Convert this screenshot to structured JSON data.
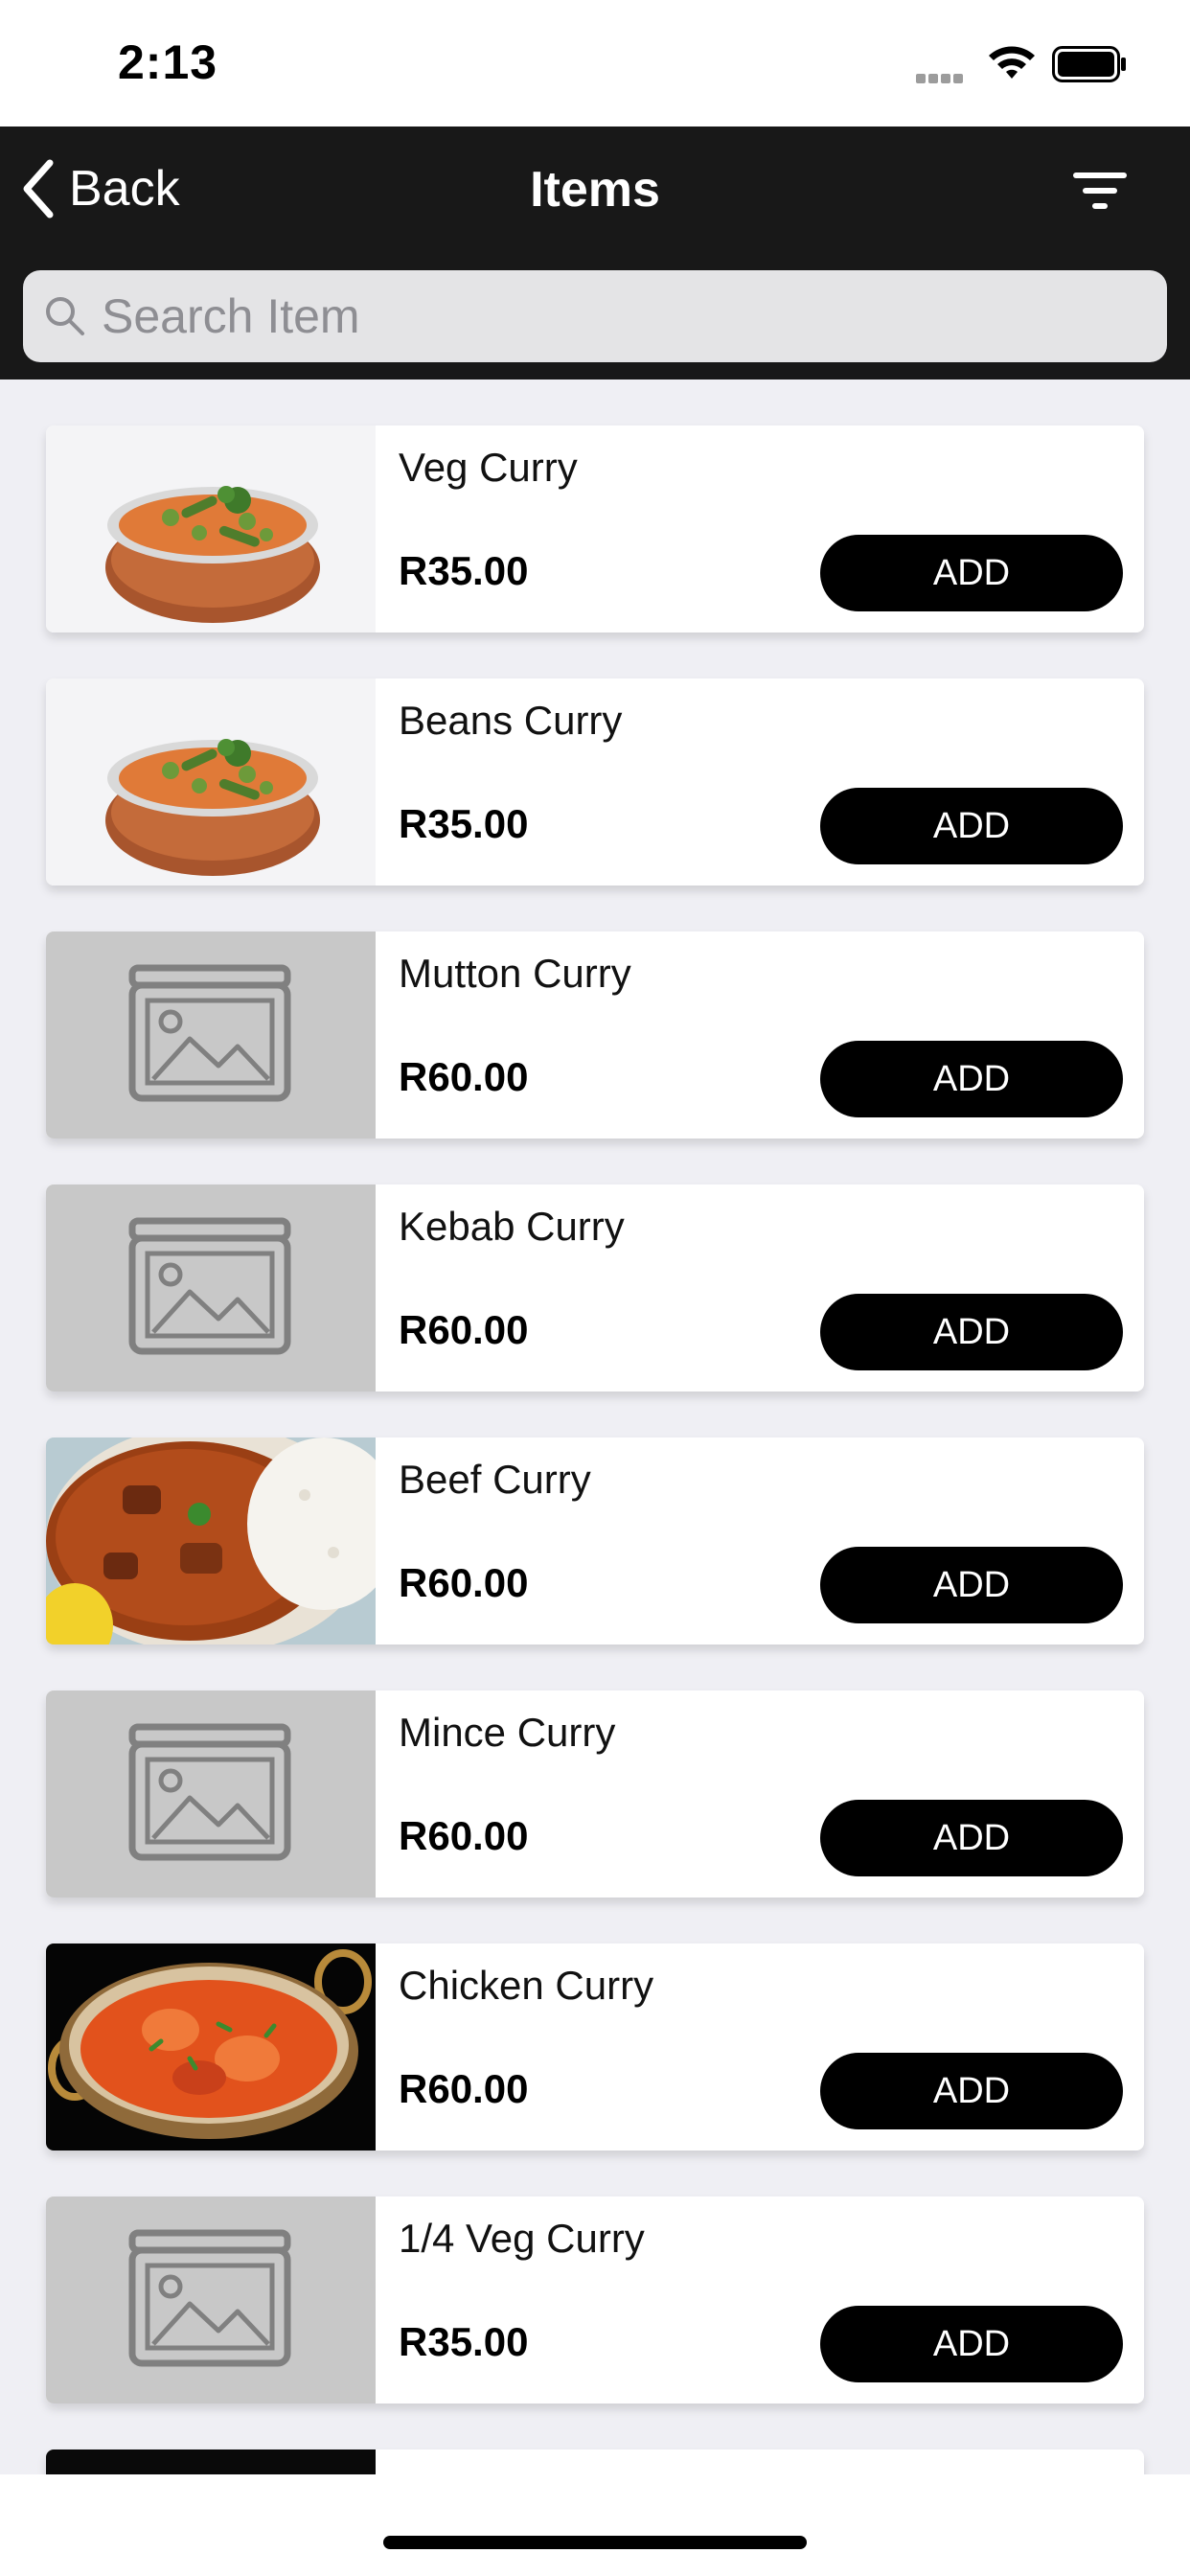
{
  "status_bar": {
    "time": "2:13"
  },
  "nav": {
    "back_label": "Back",
    "title": "Items"
  },
  "search": {
    "placeholder": "Search Item",
    "value": ""
  },
  "items": [
    {
      "name": "Veg Curry",
      "price": "R35.00",
      "add_label": "ADD",
      "image": "veg-curry-photo"
    },
    {
      "name": "Beans Curry",
      "price": "R35.00",
      "add_label": "ADD",
      "image": "veg-curry-photo"
    },
    {
      "name": "Mutton Curry",
      "price": "R60.00",
      "add_label": "ADD",
      "image": "placeholder-image-icon"
    },
    {
      "name": "Kebab Curry",
      "price": "R60.00",
      "add_label": "ADD",
      "image": "placeholder-image-icon"
    },
    {
      "name": "Beef Curry",
      "price": "R60.00",
      "add_label": "ADD",
      "image": "beef-curry-photo"
    },
    {
      "name": "Mince Curry",
      "price": "R60.00",
      "add_label": "ADD",
      "image": "placeholder-image-icon"
    },
    {
      "name": "Chicken Curry",
      "price": "R60.00",
      "add_label": "ADD",
      "image": "chicken-curry-photo"
    },
    {
      "name": "1/4 Veg Curry",
      "price": "R35.00",
      "add_label": "ADD",
      "image": "placeholder-image-icon"
    }
  ],
  "colors": {
    "nav_background": "#181818",
    "button_background": "#000000",
    "list_background": "#efeff4",
    "placeholder_background": "#c8c8c8"
  }
}
